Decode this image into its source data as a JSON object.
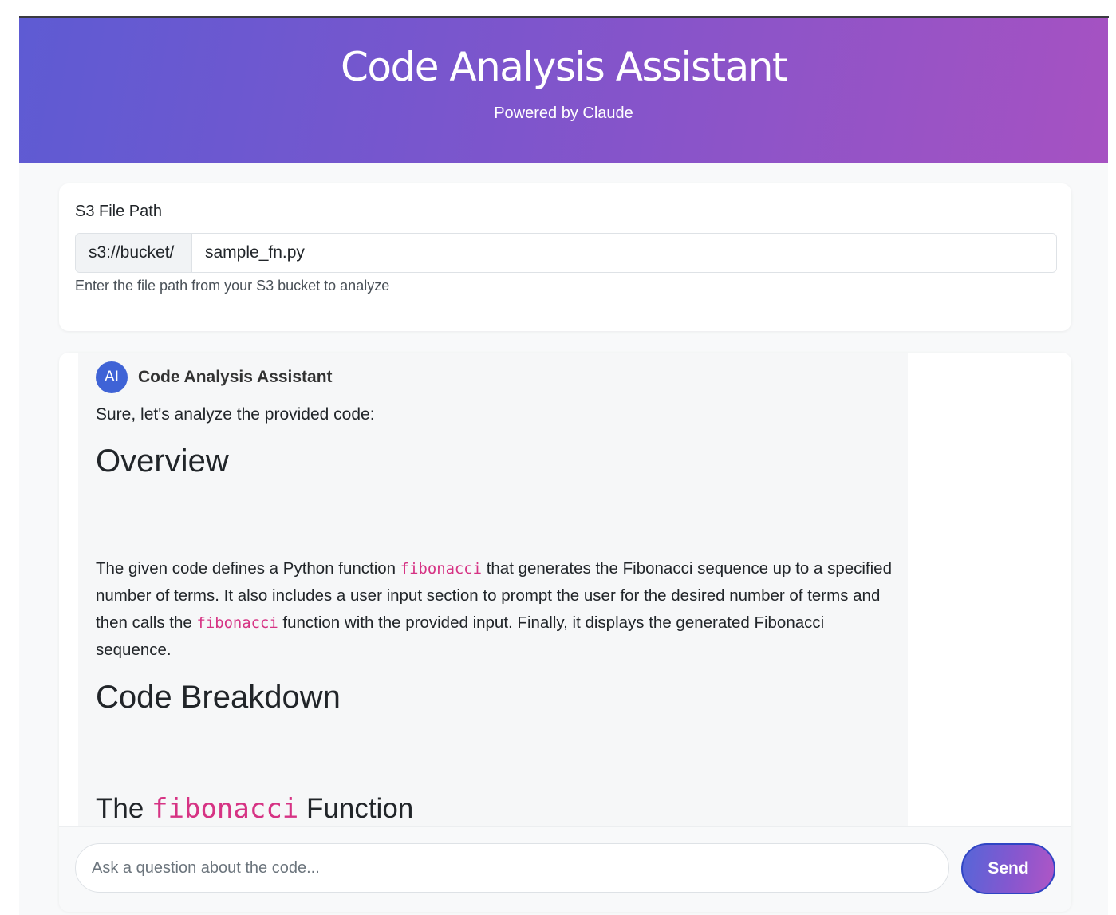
{
  "header": {
    "title": "Code Analysis Assistant",
    "subtitle": "Powered by Claude"
  },
  "file_path": {
    "label": "S3 File Path",
    "prefix": "s3://bucket/",
    "value": "sample_fn.py",
    "help": "Enter the file path from your S3 bucket to analyze"
  },
  "message": {
    "avatar": "AI",
    "sender": "Code Analysis Assistant",
    "intro": "Sure, let's analyze the provided code:",
    "heading_overview": "Overview",
    "paragraph": {
      "p1": "The given code defines a Python function ",
      "code1": "fibonacci",
      "p2": " that generates the Fibonacci sequence up to a specified number of terms. It also includes a user input section to prompt the user for the desired number of terms and then calls the ",
      "code2": "fibonacci",
      "p3": " function with the provided input. Finally, it displays the generated Fibonacci sequence."
    },
    "heading_breakdown": "Code Breakdown",
    "heading_function": {
      "pre": "The ",
      "code": "fibonacci",
      "post": " Function"
    }
  },
  "composer": {
    "placeholder": "Ask a question about the code...",
    "send_label": "Send"
  },
  "colors": {
    "header_gradient_start": "#5e5bd3",
    "header_gradient_end": "#a652c2",
    "avatar": "#3f63d6",
    "inline_code": "#d63384"
  }
}
